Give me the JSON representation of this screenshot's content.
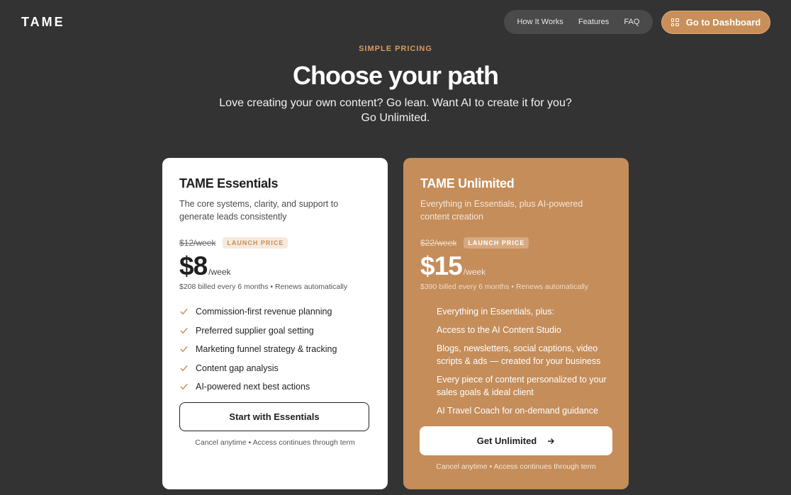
{
  "brand": {
    "logo": "TAME"
  },
  "nav": {
    "items": [
      "How It Works",
      "Features",
      "FAQ"
    ]
  },
  "dashboard_button": {
    "label": "Go to Dashboard",
    "icon": "grid-icon"
  },
  "hero": {
    "eyebrow": "SIMPLE PRICING",
    "title": "Choose your path",
    "subtitle": "Love creating your own content? Go lean. Want AI to create it for you? Go Unlimited."
  },
  "plans": {
    "essentials": {
      "name": "TAME Essentials",
      "description": "The core systems, clarity, and support to generate leads consistently",
      "old_price": "$12/week",
      "badge": "LAUNCH PRICE",
      "price": "$8",
      "per": "/week",
      "billing": "$208 billed every 6 months • Renews automatically",
      "features": [
        "Commission-first revenue planning",
        "Preferred supplier goal setting",
        "Marketing funnel strategy & tracking",
        "Content gap analysis",
        "AI-powered next best actions"
      ],
      "cta": "Start with Essentials",
      "note": "Cancel anytime • Access continues through term"
    },
    "unlimited": {
      "name": "TAME Unlimited",
      "description": "Everything in Essentials, plus AI-powered content creation",
      "old_price": "$22/week",
      "badge": "LAUNCH PRICE",
      "price": "$15",
      "per": "/week",
      "billing": "$390 billed every 6 months • Renews automatically",
      "features": [
        "Everything in Essentials, plus:",
        "Access to the AI Content Studio",
        "Blogs, newsletters, social captions, video scripts & ads — created for your business",
        "Every piece of content personalized to your sales goals & ideal client",
        "AI Travel Coach for on-demand guidance"
      ],
      "cta": "Get Unlimited",
      "cta_icon": "arrow-right-icon",
      "note": "Cancel anytime • Access continues through term"
    }
  },
  "colors": {
    "background": "#333333",
    "accent": "#c98f58",
    "unlimited_card": "#c48d5a"
  }
}
